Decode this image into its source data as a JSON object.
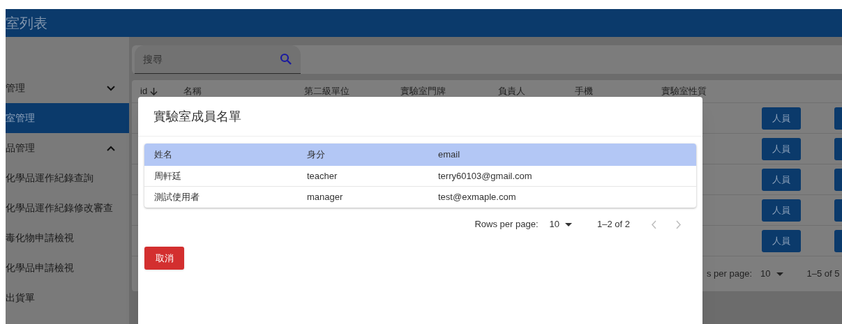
{
  "header": {
    "title": "室列表"
  },
  "sidebar": {
    "items": [
      {
        "label": "管理",
        "kind": "group",
        "expanded": false,
        "selected": false
      },
      {
        "label": "室管理",
        "kind": "item",
        "selected": true
      },
      {
        "label": "品管理",
        "kind": "group",
        "expanded": true,
        "selected": false,
        "children": [
          {
            "label": "化學品運作紀錄查詢",
            "kind": "item",
            "selected": false
          },
          {
            "label": "化學品運作紀錄修改審查",
            "kind": "item",
            "selected": false
          },
          {
            "label": "毒化物申請檢視",
            "kind": "item",
            "selected": false
          },
          {
            "label": "化學品申請檢視",
            "kind": "item",
            "selected": false
          },
          {
            "label": "出貨單",
            "kind": "item",
            "selected": false
          }
        ]
      }
    ]
  },
  "search": {
    "placeholder": "搜尋"
  },
  "table": {
    "columns": [
      {
        "label": "id",
        "sorted": true
      },
      {
        "label": "名稱",
        "sorted": false
      },
      {
        "label": "第二級單位",
        "sorted": false
      },
      {
        "label": "實驗室門牌",
        "sorted": false
      },
      {
        "label": "負責人",
        "sorted": false
      },
      {
        "label": "手機",
        "sorted": false
      },
      {
        "label": "實驗室性質",
        "sorted": false
      }
    ],
    "rows": [
      {
        "action": "人員"
      },
      {
        "action": "人員"
      },
      {
        "action": "人員"
      },
      {
        "action": "人員"
      },
      {
        "action": "人員"
      }
    ],
    "pagination": {
      "rows_per_page_label": "s per page:",
      "rows_per_page": "10",
      "range": "1–5 of 5"
    }
  },
  "dialog": {
    "title": "實驗室成員名單",
    "columns": [
      "姓名",
      "身分",
      "email"
    ],
    "rows": [
      [
        "周軒廷",
        "teacher",
        "terry60103@gmail.com"
      ],
      [
        "測試使用者",
        "manager",
        "test@exmaple.com"
      ]
    ],
    "pagination": {
      "rows_per_page_label": "Rows per page:",
      "rows_per_page": "10",
      "range": "1–2 of 2",
      "prev_disabled": true,
      "next_disabled": true
    },
    "cancel": "取消"
  }
}
